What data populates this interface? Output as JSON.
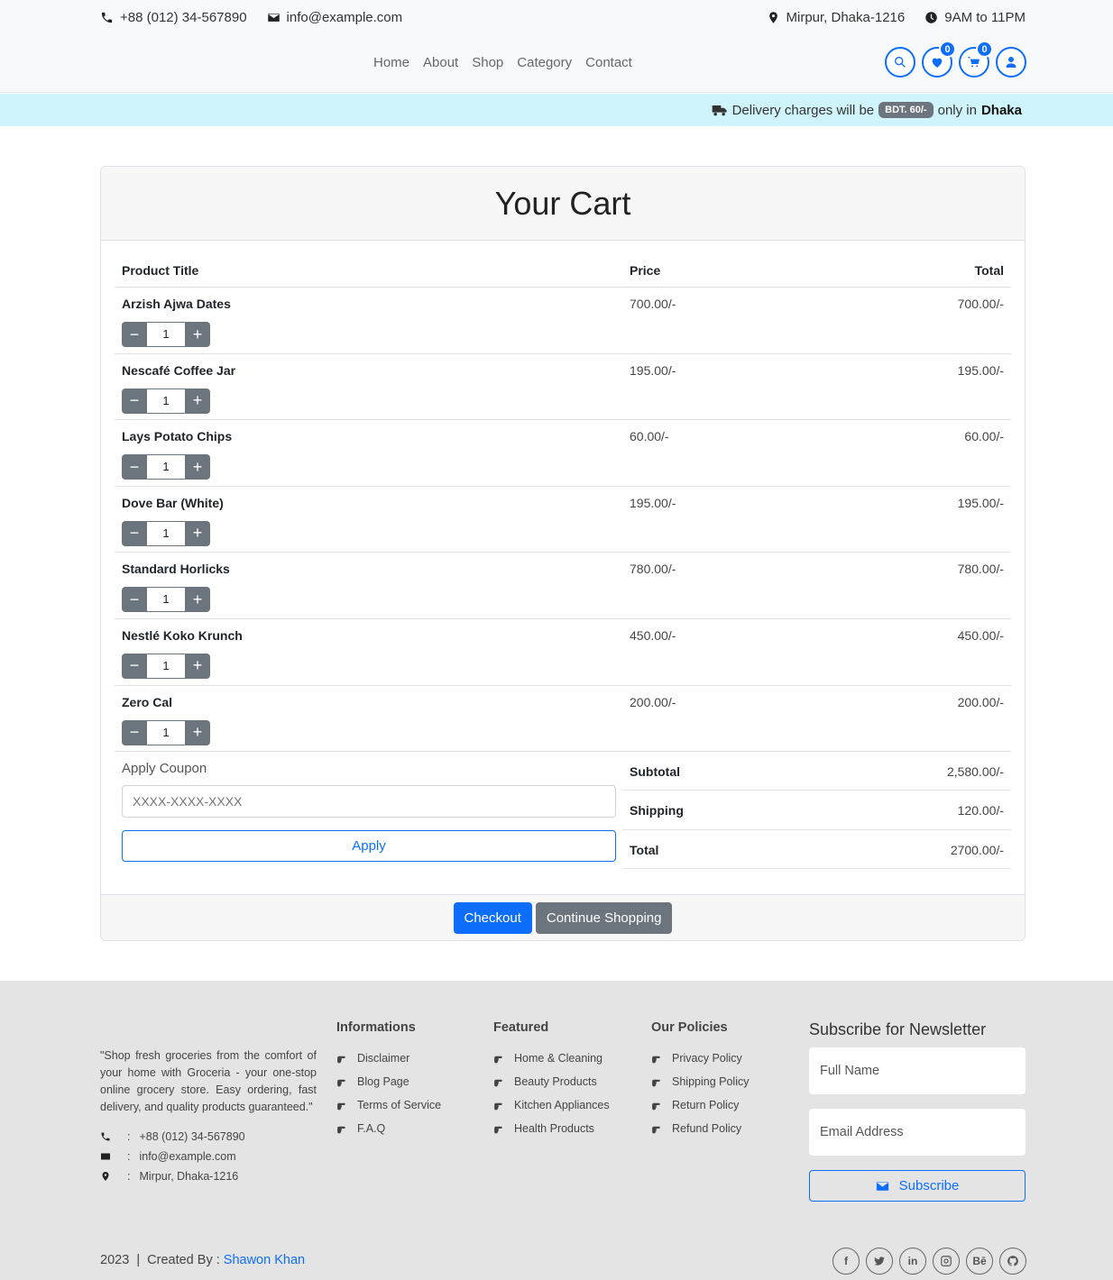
{
  "topbar": {
    "phone": "+88 (012) 34-567890",
    "email": "info@example.com",
    "location": "Mirpur, Dhaka-1216",
    "hours": "9AM to 11PM"
  },
  "nav": [
    "Home",
    "About",
    "Shop",
    "Category",
    "Contact"
  ],
  "header_icons": {
    "wishlist_count": "0",
    "cart_count": "0"
  },
  "delivery": {
    "prefix": "Delivery charges will be",
    "amount": "BDT. 60/-",
    "middle": "only in",
    "city": "Dhaka"
  },
  "cart": {
    "title": "Your Cart",
    "headers": {
      "product": "Product Title",
      "price": "Price",
      "total": "Total"
    },
    "items": [
      {
        "name": "Arzish Ajwa Dates",
        "qty": "1",
        "price": "700.00/-",
        "total": "700.00/-"
      },
      {
        "name": "Nescafé Coffee Jar",
        "qty": "1",
        "price": "195.00/-",
        "total": "195.00/-"
      },
      {
        "name": "Lays Potato Chips",
        "qty": "1",
        "price": "60.00/-",
        "total": "60.00/-"
      },
      {
        "name": "Dove Bar (White)",
        "qty": "1",
        "price": "195.00/-",
        "total": "195.00/-"
      },
      {
        "name": "Standard Horlicks",
        "qty": "1",
        "price": "780.00/-",
        "total": "780.00/-"
      },
      {
        "name": "Nestlé Koko Krunch",
        "qty": "1",
        "price": "450.00/-",
        "total": "450.00/-"
      },
      {
        "name": "Zero Cal",
        "qty": "1",
        "price": "200.00/-",
        "total": "200.00/-"
      }
    ],
    "coupon": {
      "label": "Apply Coupon",
      "placeholder": "XXXX-XXXX-XXXX",
      "button": "Apply"
    },
    "summary": [
      {
        "label": "Subtotal",
        "value": "2,580.00/-"
      },
      {
        "label": "Shipping",
        "value": "120.00/-"
      },
      {
        "label": "Total",
        "value": "2700.00/-"
      }
    ],
    "checkout": "Checkout",
    "continue": "Continue Shopping"
  },
  "footer": {
    "about": "\"Shop fresh groceries from the comfort of your home with Groceria - your one-stop online grocery store. Easy ordering, fast delivery, and quality products guaranteed.\"",
    "contact": [
      {
        "icon": "phone-icon",
        "text": "+88 (012) 34-567890"
      },
      {
        "icon": "envelope-icon",
        "text": "info@example.com"
      },
      {
        "icon": "map-marker-icon",
        "text": "Mirpur, Dhaka-1216"
      }
    ],
    "columns": [
      {
        "title": "Informations",
        "links": [
          "Disclaimer",
          "Blog Page",
          "Terms of Service",
          "F.A.Q"
        ]
      },
      {
        "title": "Featured",
        "links": [
          "Home & Cleaning",
          "Beauty Products",
          "Kitchen Appliances",
          "Health Products"
        ]
      },
      {
        "title": "Our Policies",
        "links": [
          "Privacy Policy",
          "Shipping Policy",
          "Return Policy",
          "Refund Policy"
        ]
      }
    ],
    "newsletter": {
      "title": "Subscribe for Newsletter",
      "name_placeholder": "Full Name",
      "email_placeholder": "Email Address",
      "button": "Subscribe"
    },
    "credits": {
      "year": "2023",
      "created_by": "Created By :",
      "author": "Shawon Khan"
    },
    "socials": [
      "facebook-icon",
      "twitter-icon",
      "linkedin-icon",
      "instagram-icon",
      "behance-icon",
      "github-icon"
    ]
  },
  "colors": {
    "primary": "#0d6efd",
    "secondary": "#6c757d",
    "info_bg": "#cff4fc",
    "footer_bg": "#e4e4e4"
  }
}
